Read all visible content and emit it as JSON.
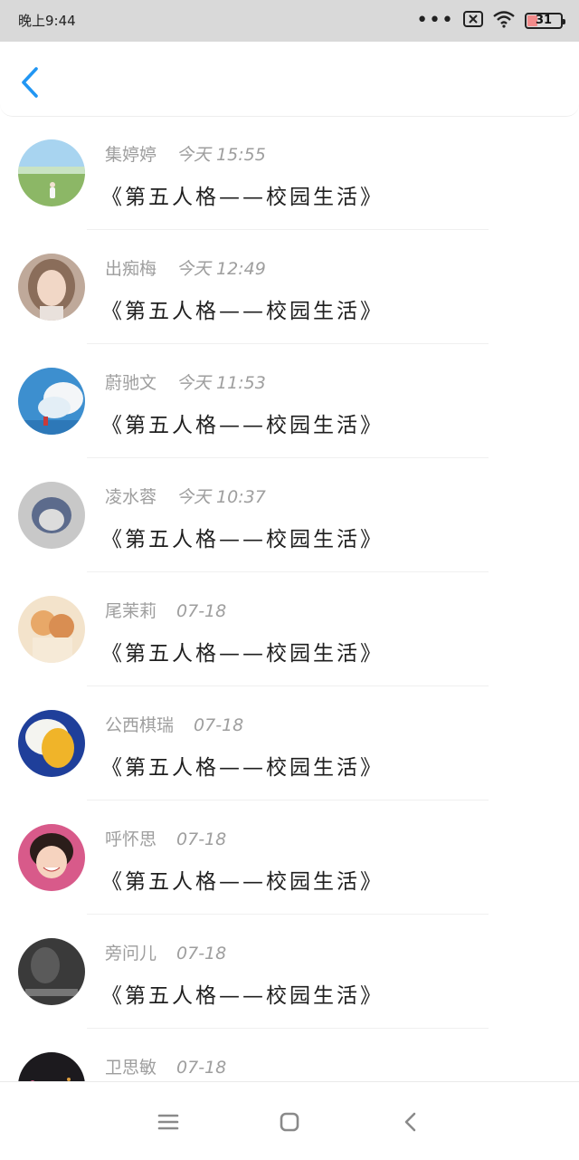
{
  "status_bar": {
    "time": "晚上9:44",
    "battery": "31",
    "battery_level": 0.31
  },
  "header": {
    "back_icon": "chevron-left-icon",
    "accent": "#2196f3"
  },
  "messages": [
    {
      "name": "集婷婷",
      "time": "今天 15:55",
      "title": "《第五人格——校园生活》"
    },
    {
      "name": "出痴梅",
      "time": "今天 12:49",
      "title": "《第五人格——校园生活》"
    },
    {
      "name": "蔚驰文",
      "time": "今天 11:53",
      "title": "《第五人格——校园生活》"
    },
    {
      "name": "凌水蓉",
      "time": "今天 10:37",
      "title": "《第五人格——校园生活》"
    },
    {
      "name": "尾茉莉",
      "time": "07-18",
      "title": "《第五人格——校园生活》"
    },
    {
      "name": "公西棋瑞",
      "time": "07-18",
      "title": "《第五人格——校园生活》"
    },
    {
      "name": "呼怀思",
      "time": "07-18",
      "title": "《第五人格——校园生活》"
    },
    {
      "name": "旁问儿",
      "time": "07-18",
      "title": "《第五人格——校园生活》"
    },
    {
      "name": "卫思敏",
      "time": "07-18",
      "title": ""
    }
  ],
  "nav_bar": {
    "menu_icon": "menu-icon",
    "home_icon": "home-square-icon",
    "back_icon": "back-chevron-icon"
  }
}
